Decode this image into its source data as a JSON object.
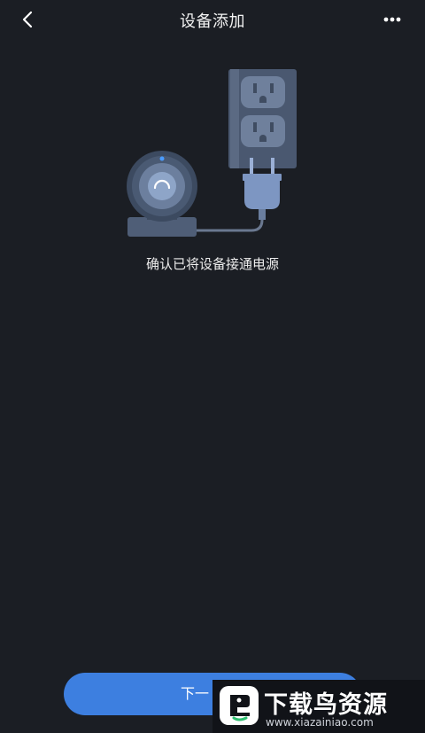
{
  "header": {
    "title": "设备添加",
    "back_icon": "chevron-left-icon",
    "more_icon": "more-horizontal-icon"
  },
  "illustration": {
    "description_icons": [
      "camera-icon",
      "power-outlet-icon",
      "power-plug-icon"
    ]
  },
  "main": {
    "instruction": "确认已将设备接通电源"
  },
  "footer": {
    "next_label": "下一"
  },
  "watermark": {
    "title": "下载鸟资源",
    "url": "www.xiazainiao.com"
  },
  "colors": {
    "background": "#1b1e24",
    "accent": "#3d7fe0",
    "illustration": "#5a6b84"
  }
}
